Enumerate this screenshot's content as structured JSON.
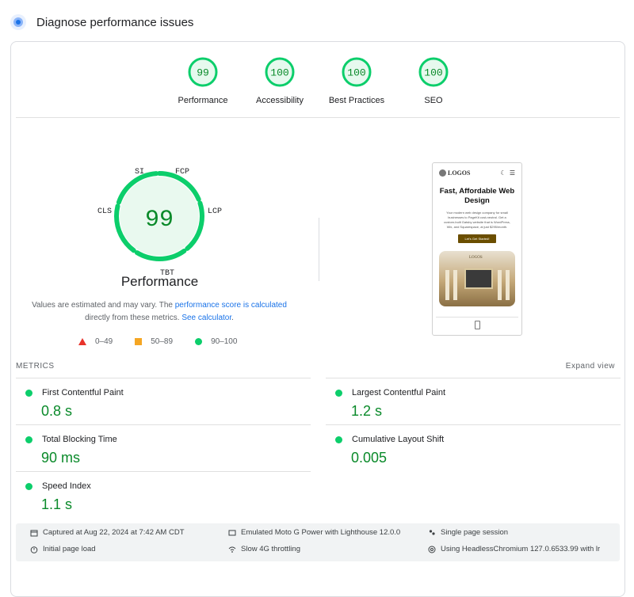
{
  "header": {
    "title": "Diagnose performance issues"
  },
  "scores": [
    {
      "value": "99",
      "label": "Performance"
    },
    {
      "value": "100",
      "label": "Accessibility"
    },
    {
      "value": "100",
      "label": "Best Practices"
    },
    {
      "value": "100",
      "label": "SEO"
    }
  ],
  "gauge": {
    "score": "99",
    "title": "Performance",
    "labels": {
      "si": "SI",
      "fcp": "FCP",
      "lcp": "LCP",
      "tbt": "TBT",
      "cls": "CLS"
    }
  },
  "estimate": {
    "text1": "Values are estimated and may vary. The ",
    "link1": "performance score is calculated",
    "text2": " directly from these metrics. ",
    "link2": "See calculator",
    "text3": "."
  },
  "legend": {
    "poor": "0–49",
    "average": "50–89",
    "good": "90–100"
  },
  "preview": {
    "logo": "LOGOS",
    "title": "Fast, Affordable Web Design",
    "text": "Your modern web design company for small businesses to PageKit cost-neutral. Get a custom-built Gatsby website that is WordPress, Wix, and Squarespace, at just $295/month.",
    "button": "Let's Get Started!",
    "image_logo": "LOGOS"
  },
  "metrics": {
    "header": "METRICS",
    "expand": "Expand view",
    "items": [
      {
        "name": "First Contentful Paint",
        "value": "0.8 s"
      },
      {
        "name": "Largest Contentful Paint",
        "value": "1.2 s"
      },
      {
        "name": "Total Blocking Time",
        "value": "90 ms"
      },
      {
        "name": "Cumulative Layout Shift",
        "value": "0.005"
      },
      {
        "name": "Speed Index",
        "value": "1.1 s"
      }
    ]
  },
  "footer": {
    "captured": "Captured at Aug 22, 2024 at 7:42 AM CDT",
    "initial": "Initial page load",
    "emulated": "Emulated Moto G Power with Lighthouse 12.0.0",
    "throttling": "Slow 4G throttling",
    "session": "Single page session",
    "browser": "Using HeadlessChromium 127.0.6533.99 with lr"
  },
  "colors": {
    "good": "#0cce6b",
    "good_text": "#0a8a2a",
    "average": "#f5a623",
    "poor": "#e8332b",
    "link": "#1a73e8"
  }
}
